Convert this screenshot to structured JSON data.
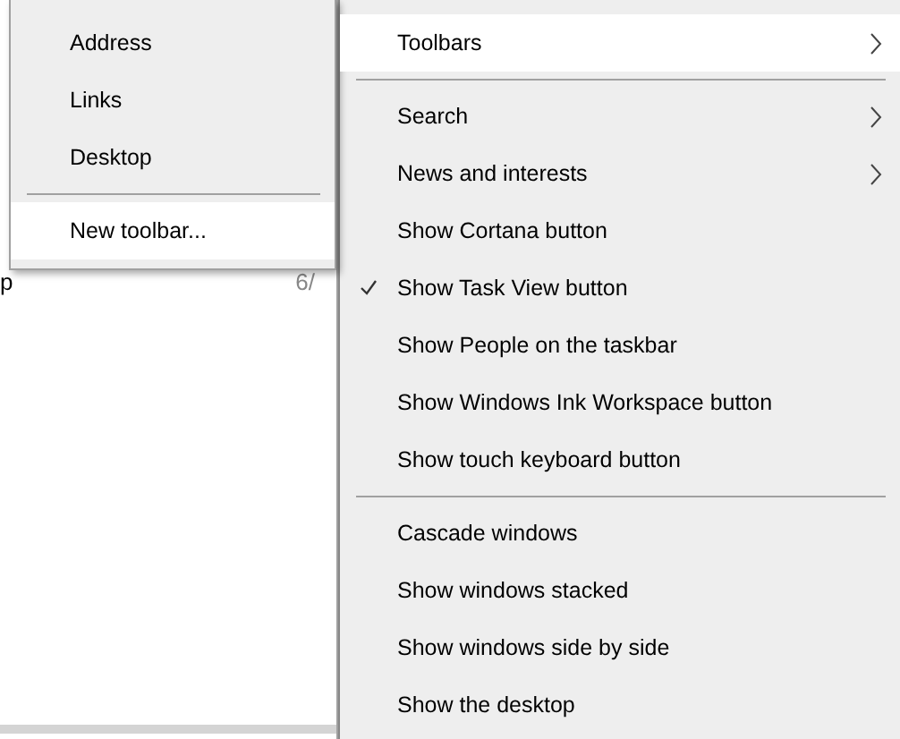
{
  "background_window": {
    "row_label": "p",
    "row_value": "6/"
  },
  "toolbars_submenu": {
    "items": [
      {
        "kind": "item",
        "label": "Address",
        "highlighted": false
      },
      {
        "kind": "item",
        "label": "Links",
        "highlighted": false
      },
      {
        "kind": "item",
        "label": "Desktop",
        "highlighted": false
      },
      {
        "kind": "divider"
      },
      {
        "kind": "item",
        "label": "New toolbar...",
        "highlighted": true
      }
    ]
  },
  "context_menu": {
    "items": [
      {
        "kind": "item",
        "label": "Toolbars",
        "highlighted": true,
        "submenu": true,
        "checked": false
      },
      {
        "kind": "divider"
      },
      {
        "kind": "item",
        "label": "Search",
        "highlighted": false,
        "submenu": true,
        "checked": false
      },
      {
        "kind": "item",
        "label": "News and interests",
        "highlighted": false,
        "submenu": true,
        "checked": false
      },
      {
        "kind": "item",
        "label": "Show Cortana button",
        "highlighted": false,
        "submenu": false,
        "checked": false
      },
      {
        "kind": "item",
        "label": "Show Task View button",
        "highlighted": false,
        "submenu": false,
        "checked": true
      },
      {
        "kind": "item",
        "label": "Show People on the taskbar",
        "highlighted": false,
        "submenu": false,
        "checked": false
      },
      {
        "kind": "item",
        "label": "Show Windows Ink Workspace button",
        "highlighted": false,
        "submenu": false,
        "checked": false
      },
      {
        "kind": "item",
        "label": "Show touch keyboard button",
        "highlighted": false,
        "submenu": false,
        "checked": false
      },
      {
        "kind": "divider"
      },
      {
        "kind": "item",
        "label": "Cascade windows",
        "highlighted": false,
        "submenu": false,
        "checked": false
      },
      {
        "kind": "item",
        "label": "Show windows stacked",
        "highlighted": false,
        "submenu": false,
        "checked": false
      },
      {
        "kind": "item",
        "label": "Show windows side by side",
        "highlighted": false,
        "submenu": false,
        "checked": false
      },
      {
        "kind": "item",
        "label": "Show the desktop",
        "highlighted": false,
        "submenu": false,
        "checked": false
      }
    ]
  }
}
